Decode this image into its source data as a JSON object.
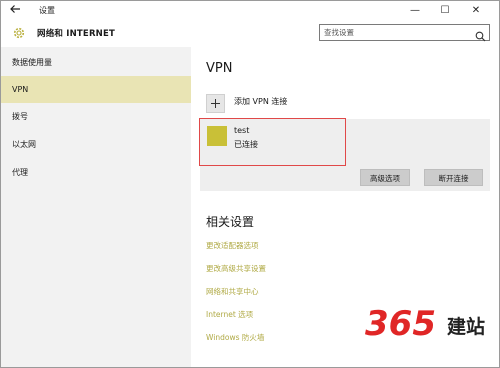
{
  "window": {
    "title": "设置",
    "back_icon": "arrow-left-icon",
    "controls": {
      "minimize": "—",
      "maximize": "☐",
      "close": "✕"
    }
  },
  "header": {
    "section_title": "网络和 INTERNET",
    "search_placeholder": "查找设置"
  },
  "sidebar": {
    "items": [
      {
        "label": "数据使用量",
        "active": false
      },
      {
        "label": "VPN",
        "active": true
      },
      {
        "label": "拨号",
        "active": false
      },
      {
        "label": "以太网",
        "active": false
      },
      {
        "label": "代理",
        "active": false
      }
    ]
  },
  "main": {
    "heading": "VPN",
    "add_icon": "+",
    "add_label": "添加 VPN 连接",
    "connection": {
      "name": "test",
      "status": "已连接",
      "advanced_button": "高级选项",
      "disconnect_button": "断开连接"
    },
    "related_heading": "相关设置",
    "related_links": [
      "更改适配器选项",
      "更改高级共享设置",
      "网络和共享中心",
      "Internet 选项",
      "Windows 防火墙"
    ]
  },
  "watermark": {
    "number": "365",
    "text": "建站"
  },
  "colors": {
    "accent": "#c9c037",
    "active_nav": "#e9e4b4",
    "link": "#b0aa45",
    "highlight_border": "#e04848",
    "watermark_red": "#e02626"
  }
}
